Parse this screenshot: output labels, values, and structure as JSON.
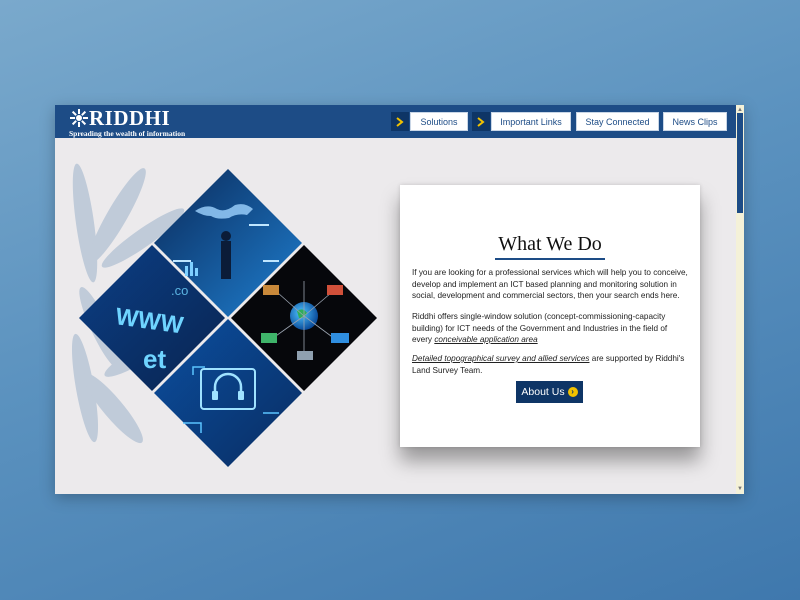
{
  "header": {
    "logo_text": "RIDDHI",
    "tagline": "Spreading the wealth of information",
    "nav": [
      {
        "label": "Solutions",
        "has_arrow": true
      },
      {
        "label": "Important Links",
        "has_arrow": true
      },
      {
        "label": "Stay Connected",
        "has_arrow": false
      },
      {
        "label": "News Clips",
        "has_arrow": false
      }
    ]
  },
  "mosaic": {
    "tiles": [
      "world-map-analytics-icon",
      "www-digital-icon",
      "satellite-gis-network-icon",
      "headphones-tech-icon"
    ],
    "tile_texts": {
      "www": "WWW",
      "net": "et",
      "com": ".co"
    }
  },
  "card": {
    "title": "What We Do",
    "para1": "If you are looking for a professional services which will help you to conceive, develop and implement an ICT based planning and monitoring solution in social, development and commercial sectors, then your search ends here.",
    "para2_text": "Riddhi offers single-window solution (concept-commissioning-capacity building) for ICT needs of the Government and Industries in the field of every",
    "para2_link": "conceivable application area",
    "para3_link": "Detailed topographical survey and allied services",
    "para3_text": " are supported by Riddhi's Land Survey Team.",
    "about_label": "About Us"
  },
  "colors": {
    "navy": "#1d4c86",
    "dark_navy": "#0e3566",
    "accent_yellow": "#f2c200",
    "page_bg": "#eceaec"
  }
}
